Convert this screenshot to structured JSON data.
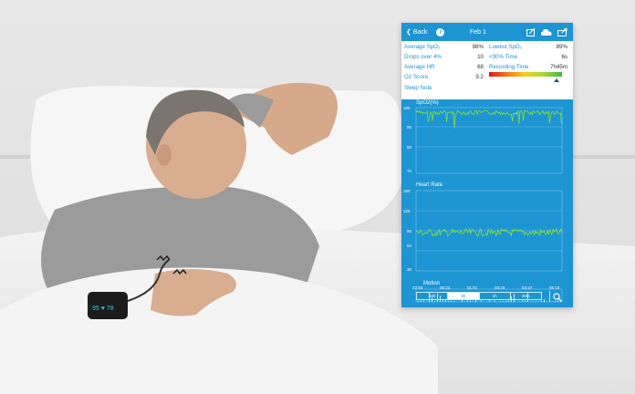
{
  "device": {
    "wrist_display": "95 ♥ 78"
  },
  "app": {
    "back_label": "Back",
    "date": "Feb 1",
    "icons": [
      "edit-icon",
      "cloud-icon",
      "share-icon",
      "info-icon"
    ]
  },
  "summary": {
    "avg_spo2_label": "Average SpO₂",
    "avg_spo2_value": "98%",
    "lowest_spo2_label": "Lowest SpO₂",
    "lowest_spo2_value": "89%",
    "drops_label": "Drops over 4%",
    "drops_value": "10",
    "below90_label": "<90% Time",
    "below90_value": "6s",
    "avg_hr_label": "Average HR",
    "avg_hr_value": "68",
    "recording_label": "Recording Time",
    "recording_value": "7h45m",
    "o2_score_label": "O2 Score",
    "o2_score_value": "9.2",
    "sleep_note_label": "Sleep Note",
    "score_level": 0.92
  },
  "charts": {
    "spo2": {
      "title": "SpO2(%)",
      "ticks": [
        "100",
        "90",
        "80",
        "70"
      ]
    },
    "hr": {
      "title": "Heart Rate",
      "ticks": [
        "150",
        "120",
        "90",
        "60",
        "30"
      ]
    },
    "motion": {
      "title": "Motion"
    }
  },
  "times": [
    "22:55",
    "00:23",
    "01:51",
    "03:19",
    "04:47",
    "06:15"
  ],
  "zoom_options": [
    "10h",
    "5h",
    "1h",
    "30m"
  ],
  "zoom_selected": "5h",
  "colors": {
    "app_blue": "#1d95d3",
    "trace_green": "#8be22a"
  }
}
